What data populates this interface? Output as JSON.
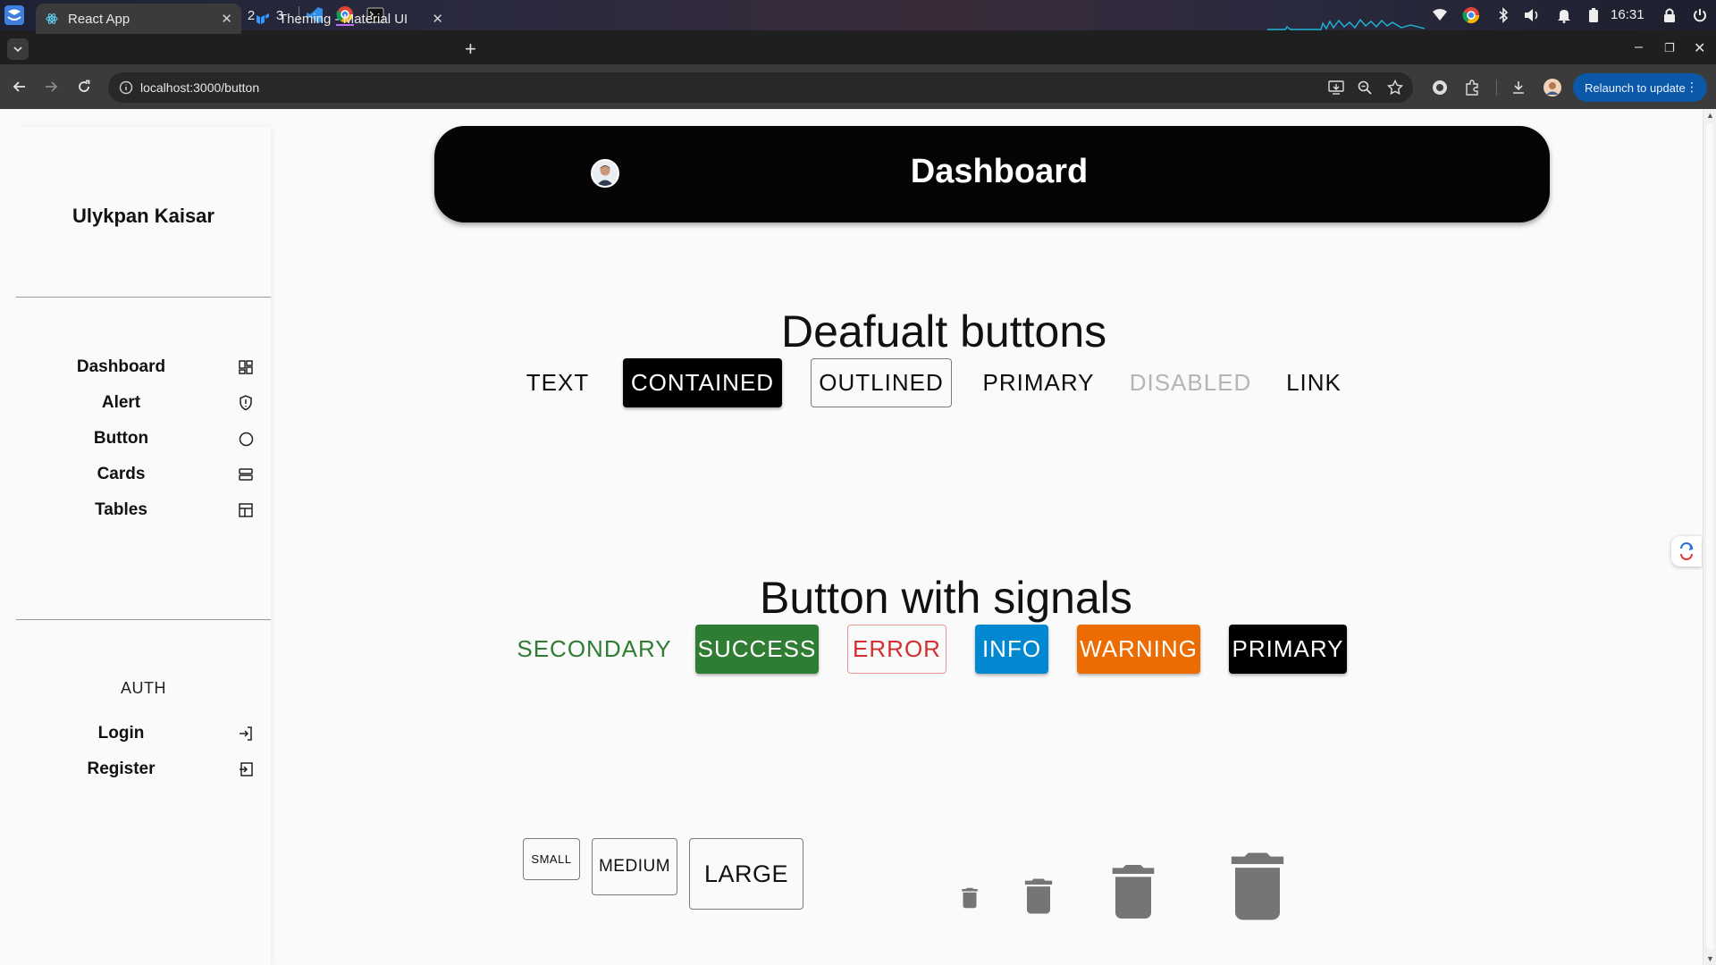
{
  "os": {
    "workspaces": [
      "1",
      "2",
      "3"
    ],
    "clock": "16:31"
  },
  "browser": {
    "tabs": [
      {
        "title": "React App",
        "active": true
      },
      {
        "title": "Theming - Material UI",
        "active": false
      }
    ],
    "url": "localhost:3000/button",
    "relaunch_label": "Relaunch to update"
  },
  "sidebar": {
    "user_name": "Ulykpan Kaisar",
    "items": [
      {
        "label": "Dashboard",
        "icon": "dashboard-grid-icon"
      },
      {
        "label": "Alert",
        "icon": "shield-icon"
      },
      {
        "label": "Button",
        "icon": "circle-icon"
      },
      {
        "label": "Cards",
        "icon": "cards-stack-icon"
      },
      {
        "label": "Tables",
        "icon": "table-icon"
      }
    ],
    "auth_title": "AUTH",
    "auth_items": [
      {
        "label": "Login",
        "icon": "login-icon"
      },
      {
        "label": "Register",
        "icon": "register-icon"
      }
    ]
  },
  "header": {
    "title": "Dashboard",
    "avatar": "user-avatar-icon"
  },
  "default_section": {
    "title": "Deafualt buttons",
    "buttons": [
      "TEXT",
      "CONTAINED",
      "OUTLINED",
      "PRIMARY",
      "DISABLED",
      "LINK"
    ]
  },
  "signals_section": {
    "title": "Button with signals",
    "buttons": [
      "SECONDARY",
      "SUCCESS",
      "ERROR",
      "INFO",
      "WARNING",
      "PRIMARY"
    ]
  },
  "colors": {
    "secondary": "#2e7d32",
    "success": "#2e7d32",
    "error": "#d32f2f",
    "info": "#0288d1",
    "warning": "#ed6c02",
    "primary": "#000000",
    "icon_gray": "#757575"
  },
  "sizes_section": {
    "buttons": [
      "SMALL",
      "MEDIUM",
      "LARGE"
    ],
    "icon_buttons": [
      "delete-icon-small",
      "delete-icon-medium",
      "delete-icon-large",
      "delete-icon-xlarge"
    ]
  }
}
